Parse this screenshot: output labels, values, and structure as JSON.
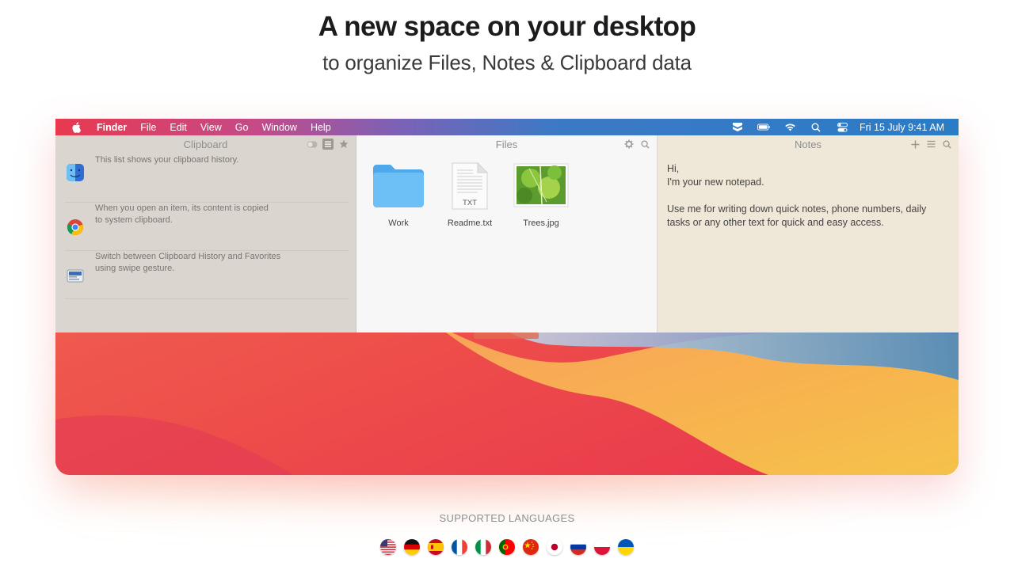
{
  "hero": {
    "title": "A new space on your desktop",
    "subtitle": "to organize Files, Notes & Clipboard data"
  },
  "menubar": {
    "items": [
      "Finder",
      "File",
      "Edit",
      "View",
      "Go",
      "Window",
      "Help"
    ],
    "clock": "Fri 15 July  9:41 AM",
    "status_icons": [
      "dropzone-icon",
      "battery-icon",
      "wifi-icon",
      "search-icon",
      "control-center-icon"
    ]
  },
  "clipboard": {
    "title": "Clipboard",
    "items": [
      {
        "text": "This list shows your clipboard history.",
        "icon": "finder-icon"
      },
      {
        "text": "When you open an item, its content is copied to system clipboard.",
        "icon": "chrome-icon"
      },
      {
        "text": "Switch between Clipboard History and Favorites using swipe gesture.",
        "icon": "preview-icon"
      }
    ]
  },
  "files": {
    "title": "Files",
    "items": [
      {
        "name": "Work",
        "type": "folder"
      },
      {
        "name": "Readme.txt",
        "type": "txt",
        "badge": "TXT"
      },
      {
        "name": "Trees.jpg",
        "type": "image"
      }
    ]
  },
  "notes": {
    "title": "Notes",
    "lines": [
      "Hi,",
      "I'm your new notepad.",
      "Use me for writing down quick notes, phone numbers, daily tasks or any other text for quick and easy access."
    ]
  },
  "languages": {
    "title": "SUPPORTED LANGUAGES",
    "flags": [
      "us",
      "de",
      "es",
      "fr",
      "it",
      "pt",
      "cn",
      "jp",
      "ru",
      "pl",
      "ua"
    ]
  },
  "colors": {
    "menubar_start": "#e8394f",
    "menubar_end": "#2a7cc5",
    "clipboard_bg": "#dad6cf",
    "files_bg": "#f7f7f7",
    "notes_bg": "#efe7d8",
    "folder_blue": "#5ab4f0"
  }
}
